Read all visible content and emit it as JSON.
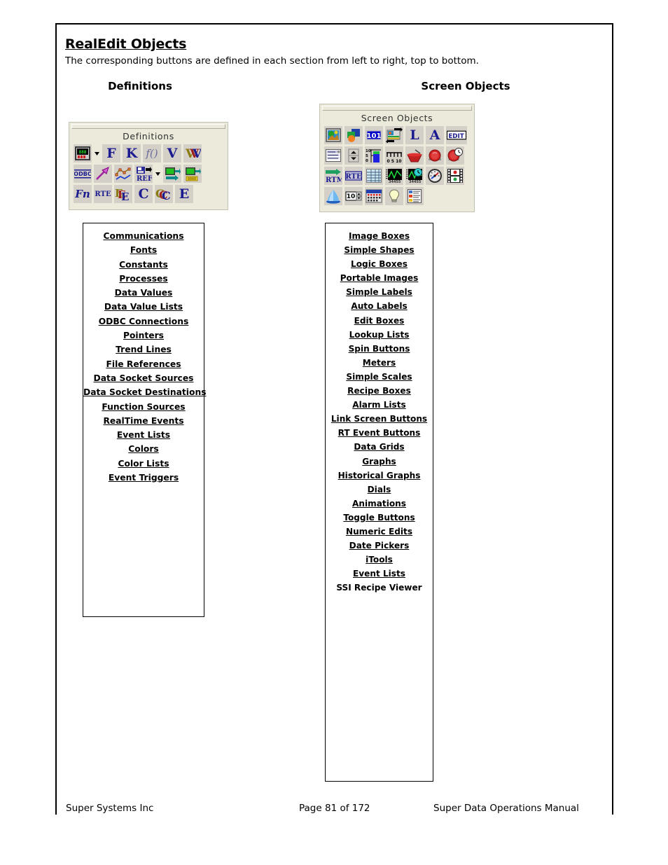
{
  "document": {
    "title": "RealEdit Objects",
    "subtitle": "The corresponding buttons are defined in each section from left to right, top to bottom."
  },
  "columns": {
    "definitions_heading": "Definitions",
    "screen_objects_heading": "Screen Objects"
  },
  "definitions_toolbar": {
    "caption": "Definitions",
    "rows": [
      [
        {
          "icon": "communications-device-icon",
          "label": ""
        },
        {
          "icon": "dropdown-arrow-icon",
          "label": "",
          "separator": true
        },
        {
          "icon": "fonts-icon",
          "label": "F"
        },
        {
          "icon": "constants-icon",
          "label": "K"
        },
        {
          "icon": "processes-icon",
          "label": "f()"
        },
        {
          "icon": "data-values-icon",
          "label": "V"
        },
        {
          "icon": "data-value-lists-icon",
          "label": "W"
        }
      ],
      [
        {
          "icon": "odbc-connections-icon",
          "label": "ODBC"
        },
        {
          "icon": "pointers-arrow-icon",
          "label": ""
        },
        {
          "icon": "trend-lines-icon",
          "label": ""
        },
        {
          "icon": "file-references-icon",
          "label": "REF"
        },
        {
          "icon": "dropdown-arrow-icon",
          "label": "",
          "separator": true
        },
        {
          "icon": "data-socket-sources-icon",
          "label": ""
        },
        {
          "icon": "data-socket-destinations-icon",
          "label": ""
        }
      ],
      [
        {
          "icon": "function-sources-icon",
          "label": "Fn"
        },
        {
          "icon": "realtime-events-icon",
          "label": "RTE"
        },
        {
          "icon": "event-lists-icon",
          "label": "E"
        },
        {
          "icon": "colors-icon",
          "label": "C"
        },
        {
          "icon": "color-lists-icon",
          "label": "C"
        },
        {
          "icon": "event-triggers-icon",
          "label": "E"
        }
      ]
    ]
  },
  "screen_objects_toolbar": {
    "caption": "Screen Objects",
    "rows": [
      [
        {
          "icon": "image-boxes-icon",
          "label": ""
        },
        {
          "icon": "simple-shapes-icon",
          "label": ""
        },
        {
          "icon": "logic-boxes-icon",
          "label": "101"
        },
        {
          "icon": "portable-images-icon",
          "label": ""
        },
        {
          "icon": "simple-labels-icon",
          "label": "L"
        },
        {
          "icon": "auto-labels-icon",
          "label": "A"
        },
        {
          "icon": "edit-boxes-icon",
          "label": "EDIT"
        }
      ],
      [
        {
          "icon": "lookup-lists-icon",
          "label": ""
        },
        {
          "icon": "spin-buttons-icon",
          "label": ""
        },
        {
          "icon": "meters-icon",
          "label": ""
        },
        {
          "icon": "simple-scales-icon",
          "label": "0 5 10"
        },
        {
          "icon": "recipe-boxes-icon",
          "label": ""
        },
        {
          "icon": "alarm-lists-icon",
          "label": ""
        },
        {
          "icon": "link-screen-buttons-icon",
          "label": ""
        }
      ],
      [
        {
          "icon": "rt-event-buttons-icon",
          "label": "RTM"
        },
        {
          "icon": "rte-icon",
          "label": "RTE"
        },
        {
          "icon": "data-grids-icon",
          "label": ""
        },
        {
          "icon": "graphs-icon",
          "label": ""
        },
        {
          "icon": "historical-graphs-icon",
          "label": ""
        },
        {
          "icon": "dials-icon",
          "label": ""
        },
        {
          "icon": "animations-icon",
          "label": ""
        }
      ],
      [
        {
          "icon": "toggle-buttons-icon",
          "label": ""
        },
        {
          "icon": "numeric-edits-icon",
          "label": "10"
        },
        {
          "icon": "date-pickers-icon",
          "label": ""
        },
        {
          "icon": "itools-icon",
          "label": ""
        },
        {
          "icon": "event-lists-viewer-icon",
          "label": ""
        }
      ]
    ]
  },
  "definitions_list": [
    {
      "label": "Communications",
      "underlined": true
    },
    {
      "label": "Fonts",
      "underlined": true
    },
    {
      "label": "Constants",
      "underlined": true
    },
    {
      "label": "Processes",
      "underlined": true
    },
    {
      "label": "Data Values",
      "underlined": true
    },
    {
      "label": "Data Value Lists",
      "underlined": true
    },
    {
      "label": "ODBC Connections",
      "underlined": true
    },
    {
      "label": "Pointers",
      "underlined": true
    },
    {
      "label": "Trend Lines",
      "underlined": true
    },
    {
      "label": "File References",
      "underlined": true
    },
    {
      "label": "Data Socket Sources",
      "underlined": true
    },
    {
      "label": "Data Socket Destinations",
      "underlined": true
    },
    {
      "label": "Function Sources",
      "underlined": true
    },
    {
      "label": "RealTime Events",
      "underlined": true
    },
    {
      "label": "Event Lists",
      "underlined": true
    },
    {
      "label": "Colors",
      "underlined": true
    },
    {
      "label": "Color Lists",
      "underlined": true
    },
    {
      "label": "Event Triggers",
      "underlined": true
    }
  ],
  "screen_objects_list": [
    {
      "label": "Image Boxes",
      "underlined": true
    },
    {
      "label": "Simple Shapes",
      "underlined": true
    },
    {
      "label": "Logic Boxes",
      "underlined": true
    },
    {
      "label": "Portable Images",
      "underlined": true
    },
    {
      "label": "Simple Labels",
      "underlined": true
    },
    {
      "label": "Auto Labels",
      "underlined": true
    },
    {
      "label": "Edit Boxes",
      "underlined": true
    },
    {
      "label": "Lookup Lists",
      "underlined": true
    },
    {
      "label": "Spin Buttons",
      "underlined": true
    },
    {
      "label": "Meters",
      "underlined": true
    },
    {
      "label": "Simple Scales",
      "underlined": true
    },
    {
      "label": "Recipe Boxes",
      "underlined": true
    },
    {
      "label": "Alarm Lists",
      "underlined": true
    },
    {
      "label": "Link Screen Buttons",
      "underlined": true
    },
    {
      "label": "RT Event Buttons",
      "underlined": true
    },
    {
      "label": "Data Grids",
      "underlined": true
    },
    {
      "label": "Graphs",
      "underlined": true
    },
    {
      "label": "Historical Graphs",
      "underlined": true
    },
    {
      "label": "Dials",
      "underlined": true
    },
    {
      "label": "Animations",
      "underlined": true
    },
    {
      "label": "Toggle Buttons",
      "underlined": true
    },
    {
      "label": "Numeric Edits",
      "underlined": true
    },
    {
      "label": "Date Pickers",
      "underlined": true
    },
    {
      "label": "iTools",
      "underlined": true
    },
    {
      "label": "Event Lists",
      "underlined": true
    },
    {
      "label": "SSI Recipe Viewer",
      "underlined": false
    }
  ],
  "footer": {
    "left": "Super Systems Inc",
    "center": "Page 81 of 172",
    "right": "Super Data Operations Manual"
  },
  "colors": {
    "toolbar_background": "#ECEADB",
    "button_face": "#D4D0C8",
    "glyph_blue": "#1B1B8F",
    "text": "#000000"
  }
}
